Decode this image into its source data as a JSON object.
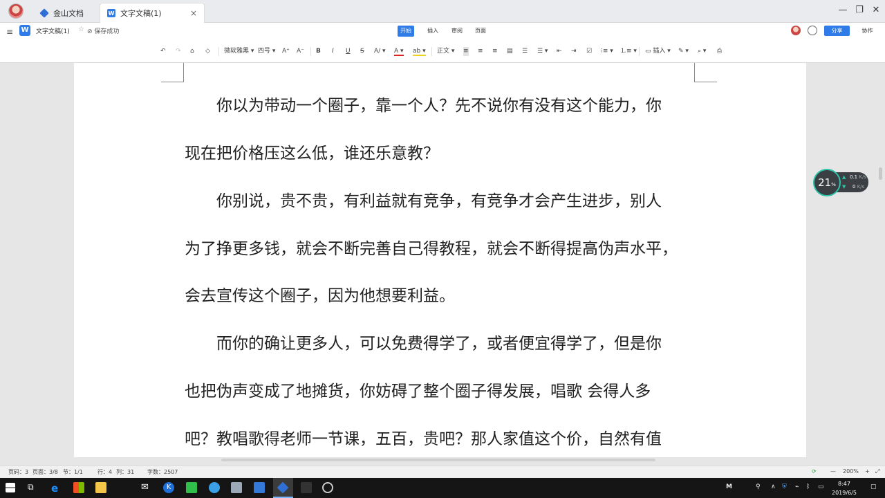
{
  "titlebar": {
    "tabs": [
      {
        "label": "金山文档"
      },
      {
        "label": "文字文稿(1)"
      }
    ],
    "close_tab_glyph": "×",
    "window_controls": {
      "minimize": "—",
      "maximize": "❐",
      "close": "✕"
    }
  },
  "menubar": {
    "doc_name": "文字文稿(1)",
    "save_status": "保存成功",
    "menus": [
      "开始",
      "插入",
      "审阅",
      "页面"
    ],
    "share_label": "分享",
    "collab_label": "协作"
  },
  "toolbar": {
    "font_name": "微软雅黑",
    "font_size": "四号",
    "style": "正文",
    "insert_label": "插入"
  },
  "document": {
    "lines": [
      "　　你以为带动一个圈子，靠一个人？先不说你有没有这个能力，你",
      "现在把价格压这么低，谁还乐意教？",
      "　　你别说，贵不贵，有利益就有竞争，有竞争才会产生进步，别人",
      "为了挣更多钱，就会不断完善自己得教程，就会不断得提高伪声水平，",
      "会去宣传这个圈子，因为他想要利益。",
      "　　而你的确让更多人，可以免费得学了，或者便宜得学了，但是你",
      "也把伪声变成了地摊货，你妨碍了整个圈子得发展，唱歌  会得人多",
      "吧？教唱歌得老师一节课，五百，贵吧？那人家值这个价，自然有值"
    ]
  },
  "speed_widget": {
    "percent": "21",
    "percent_unit": "%",
    "upload": "0.1",
    "upload_unit": "K/s",
    "download": "0",
    "download_unit": "K/s"
  },
  "statusbar": {
    "page_num": "页码：3",
    "pages": "页面：3/8",
    "section": "节：1/1",
    "row": "行：4",
    "col": "列：31",
    "word_count": "字数：2507",
    "zoom": "200%"
  },
  "taskbar": {
    "time": "8:47",
    "date": "2019/6/5",
    "ime": "M"
  },
  "colors": {
    "accent": "#2f7be8",
    "widget_ring": "#2cc3a6"
  }
}
